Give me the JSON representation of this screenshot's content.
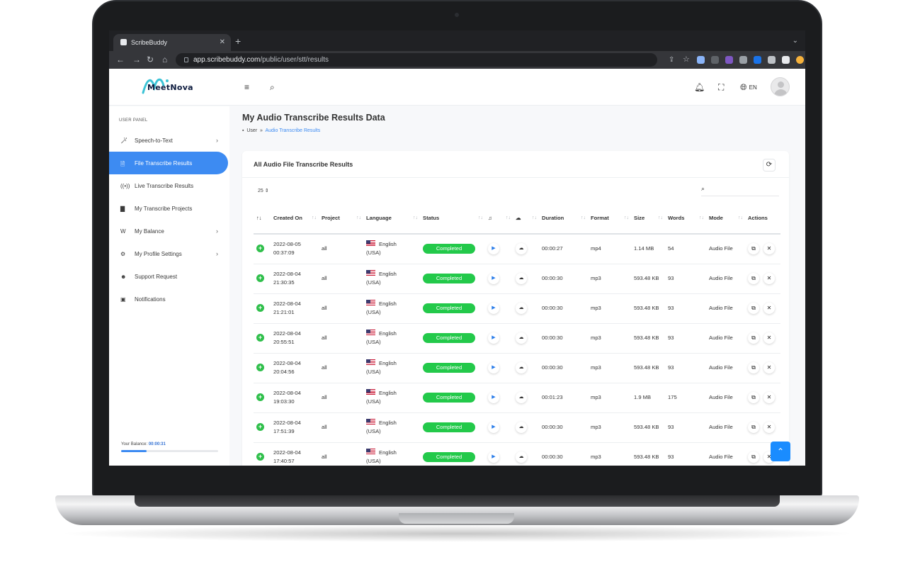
{
  "browser": {
    "tab_title": "ScribeBuddy",
    "tab_close": "✕",
    "new_tab": "+",
    "url_host": "app.scribebuddy.com",
    "url_path": "/public/user/stt/results"
  },
  "header": {
    "logo_text": "MeetNova",
    "lang": "EN"
  },
  "sidebar": {
    "panel_label": "USER PANEL",
    "items": [
      {
        "label": "Speech-to-Text",
        "icon": "magic-wand-icon",
        "has_chevron": true
      },
      {
        "label": "File Transcribe Results",
        "icon": "file-icon",
        "active": true
      },
      {
        "label": "Live Transcribe Results",
        "icon": "broadcast-icon"
      },
      {
        "label": "My Transcribe Projects",
        "icon": "archive-icon"
      },
      {
        "label": "My Balance",
        "icon": "wallet-icon",
        "has_chevron": true
      },
      {
        "label": "My Profile Settings",
        "icon": "user-cog-icon",
        "has_chevron": true
      },
      {
        "label": "Support Request",
        "icon": "support-icon"
      },
      {
        "label": "Notifications",
        "icon": "bell-icon"
      }
    ],
    "balance_label": "Your Balance:",
    "balance_value": "00:00:31",
    "balance_fill": 0.26
  },
  "page": {
    "title": "My Audio Transcribe Results Data",
    "breadcrumb_root": "User",
    "breadcrumb_sep": "»",
    "breadcrumb_current": "Audio Transcribe Results"
  },
  "card": {
    "title": "All Audio File Transcribe Results",
    "per_page": "25"
  },
  "table": {
    "headers": [
      "",
      "Created On",
      "Project",
      "Language",
      "Status",
      "♫",
      "☁",
      "Duration",
      "Format",
      "Size",
      "Words",
      "Mode",
      "Actions"
    ],
    "rows": [
      {
        "date": "2022-08-05",
        "time": "00:37:09",
        "project": "all",
        "lang1": "English",
        "lang2": "(USA)",
        "status": "Completed",
        "duration": "00:00:27",
        "format": "mp4",
        "size": "1.14 MB",
        "words": "54",
        "mode": "Audio File"
      },
      {
        "date": "2022-08-04",
        "time": "21:30:35",
        "project": "all",
        "lang1": "English",
        "lang2": "(USA)",
        "status": "Completed",
        "duration": "00:00:30",
        "format": "mp3",
        "size": "593.48 KB",
        "words": "93",
        "mode": "Audio File"
      },
      {
        "date": "2022-08-04",
        "time": "21:21:01",
        "project": "all",
        "lang1": "English",
        "lang2": "(USA)",
        "status": "Completed",
        "duration": "00:00:30",
        "format": "mp3",
        "size": "593.48 KB",
        "words": "93",
        "mode": "Audio File"
      },
      {
        "date": "2022-08-04",
        "time": "20:55:51",
        "project": "all",
        "lang1": "English",
        "lang2": "(USA)",
        "status": "Completed",
        "duration": "00:00:30",
        "format": "mp3",
        "size": "593.48 KB",
        "words": "93",
        "mode": "Audio File"
      },
      {
        "date": "2022-08-04",
        "time": "20:04:56",
        "project": "all",
        "lang1": "English",
        "lang2": "(USA)",
        "status": "Completed",
        "duration": "00:00:30",
        "format": "mp3",
        "size": "593.48 KB",
        "words": "93",
        "mode": "Audio File"
      },
      {
        "date": "2022-08-04",
        "time": "19:03:30",
        "project": "all",
        "lang1": "English",
        "lang2": "(USA)",
        "status": "Completed",
        "duration": "00:01:23",
        "format": "mp3",
        "size": "1.9 MB",
        "words": "175",
        "mode": "Audio File"
      },
      {
        "date": "2022-08-04",
        "time": "17:51:39",
        "project": "all",
        "lang1": "English",
        "lang2": "(USA)",
        "status": "Completed",
        "duration": "00:00:30",
        "format": "mp3",
        "size": "593.48 KB",
        "words": "93",
        "mode": "Audio File"
      },
      {
        "date": "2022-08-04",
        "time": "17:40:57",
        "project": "all",
        "lang1": "English",
        "lang2": "(USA)",
        "status": "Completed",
        "duration": "00:00:30",
        "format": "mp3",
        "size": "593.48 KB",
        "words": "93",
        "mode": "Audio File"
      }
    ]
  },
  "colors": {
    "accent": "#3d8bf2",
    "success": "#23c94a",
    "laptop": "#1b1c1e"
  }
}
